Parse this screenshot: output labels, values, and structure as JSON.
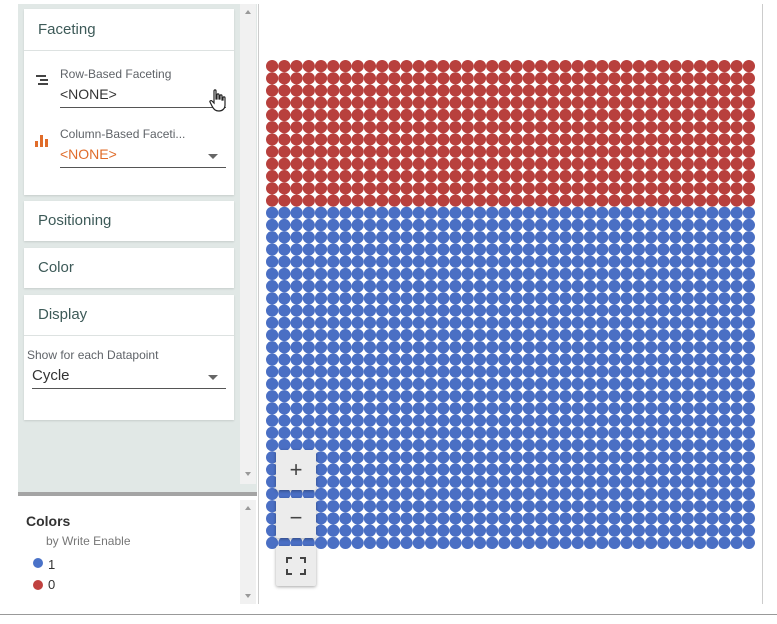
{
  "faceting": {
    "title": "Faceting",
    "row_label": "Row-Based Faceting",
    "row_value": "<NONE>",
    "col_label": "Column-Based Faceti...",
    "col_value": "<NONE>"
  },
  "positioning": {
    "title": "Positioning"
  },
  "color": {
    "title": "Color"
  },
  "display": {
    "title": "Display",
    "show_label": "Show for each Datapoint",
    "show_value": "Cycle"
  },
  "legend": {
    "title": "Colors",
    "subtitle": "by Write Enable",
    "items": [
      {
        "label": "1",
        "color": "#4a72c8"
      },
      {
        "label": "0",
        "color": "#c0413f"
      }
    ]
  },
  "zoom": {
    "in": "+",
    "out": "−"
  },
  "colors": {
    "accent_orange": "#e06c2a",
    "red": "#b8403d",
    "blue": "#4a6fc4"
  },
  "chart_data": {
    "type": "scatter",
    "series": [
      {
        "name": "0",
        "color": "#b8403d",
        "rows": 12,
        "cols": 40
      },
      {
        "name": "1",
        "color": "#4a6fc4",
        "rows": 28,
        "cols": 40
      }
    ]
  }
}
